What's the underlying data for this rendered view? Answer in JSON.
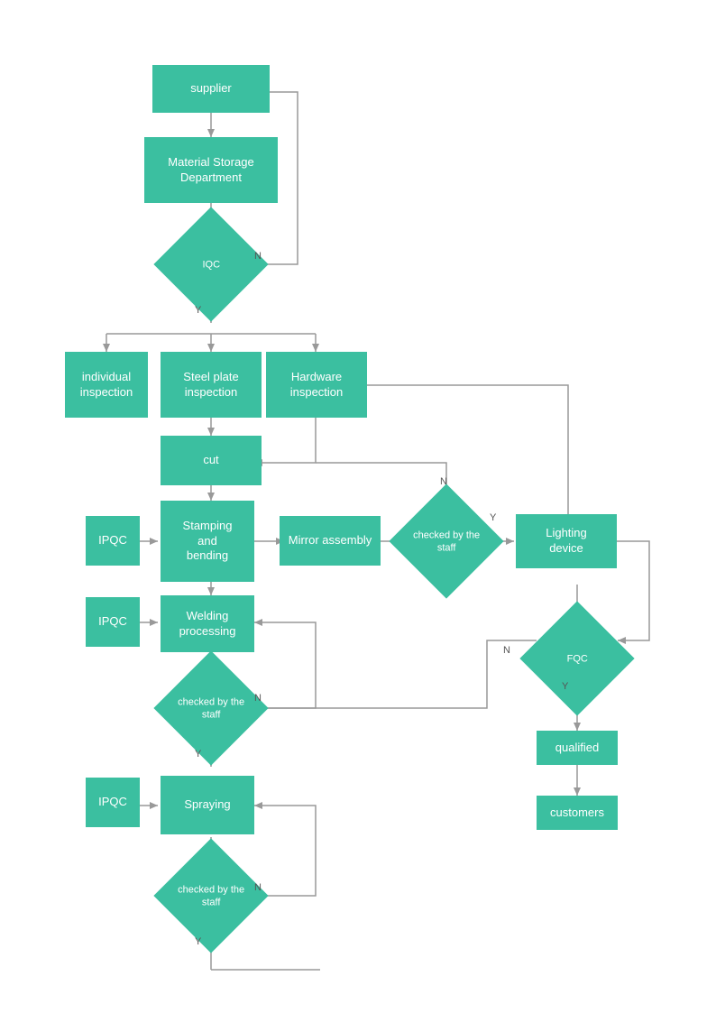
{
  "nodes": {
    "supplier": {
      "label": "supplier"
    },
    "material_storage": {
      "label": "Material Storage\nDepartment"
    },
    "iqc": {
      "label": "IQC"
    },
    "individual_inspection": {
      "label": "individual\ninspection"
    },
    "steel_plate": {
      "label": "Steel plate\ninspection"
    },
    "hardware_inspection": {
      "label": "Hardware\ninspection"
    },
    "cut": {
      "label": "cut"
    },
    "ipqc1": {
      "label": "IPQC"
    },
    "stamping": {
      "label": "Stamping\nand\nbending"
    },
    "mirror_assembly": {
      "label": "Mirror assembly"
    },
    "checked_staff1": {
      "label": "checked by\nthe staff"
    },
    "lighting_device": {
      "label": "Lighting\ndevice"
    },
    "ipqc2": {
      "label": "IPQC"
    },
    "welding": {
      "label": "Welding\nprocessing"
    },
    "checked_staff2": {
      "label": "checked by\nthe staff"
    },
    "fqc": {
      "label": "FQC"
    },
    "ipqc3": {
      "label": "IPQC"
    },
    "spraying": {
      "label": "Spraying"
    },
    "qualified": {
      "label": "qualified"
    },
    "checked_staff3": {
      "label": "checked by\nthe staff"
    },
    "customers": {
      "label": "customers"
    }
  },
  "labels": {
    "n1": "N",
    "y1": "Y",
    "n2": "N",
    "y2": "Y",
    "n3": "N",
    "y3": "Y",
    "n4": "N",
    "y4": "Y",
    "n5": "N",
    "y5": "Y"
  }
}
